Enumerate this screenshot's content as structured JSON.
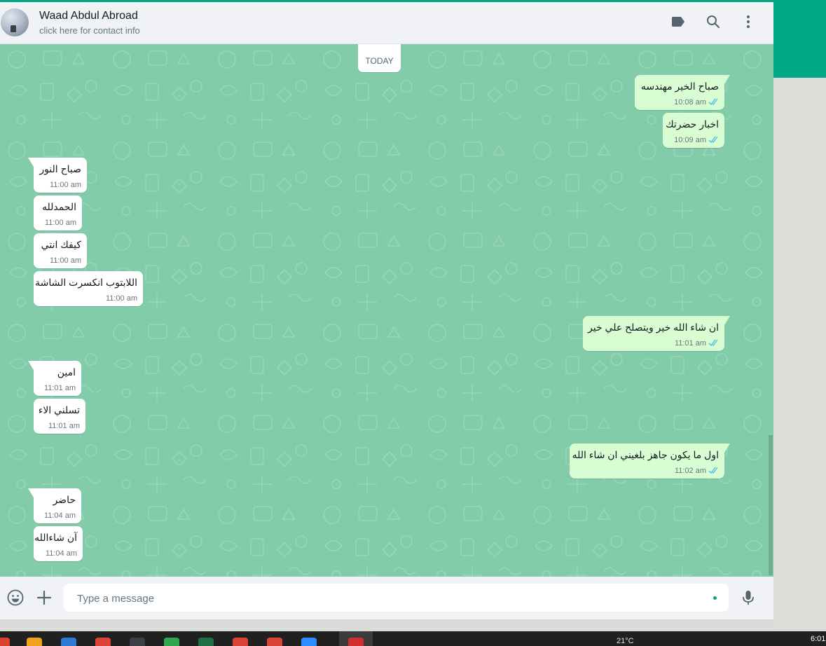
{
  "header": {
    "contact_name": "Waad Abdul Abroad",
    "contact_subtitle": "click here for contact info",
    "icons": [
      "label-icon",
      "search-icon",
      "menu-icon"
    ]
  },
  "chat": {
    "date_label": "TODAY",
    "messages": [
      {
        "direction": "out",
        "text": "صباح الخير مهندسه",
        "time": "10:08 am",
        "status": "read"
      },
      {
        "direction": "out",
        "text": "اخبار حضرتك",
        "time": "10:09 am",
        "status": "read"
      },
      {
        "direction": "in",
        "text": "صباح النور",
        "time": "11:00 am"
      },
      {
        "direction": "in",
        "text": "الحمدلله",
        "time": "11:00 am"
      },
      {
        "direction": "in",
        "text": "كيفك انتي",
        "time": "11:00 am"
      },
      {
        "direction": "in",
        "text": "اللابتوب انكسرت الشاشة",
        "time": "11:00 am"
      },
      {
        "direction": "out",
        "text": "ان شاء الله خير  ويتصلح علي خير",
        "time": "11:01 am",
        "status": "read"
      },
      {
        "direction": "in",
        "text": "امين",
        "time": "11:01 am"
      },
      {
        "direction": "in",
        "text": "تسلني الاء",
        "time": "11:01 am"
      },
      {
        "direction": "out",
        "text": "اول ما يكون جاهز بلغيني ان شاء الله",
        "time": "11:02 am",
        "status": "read"
      },
      {
        "direction": "in",
        "text": "حاضر",
        "time": "11:04 am"
      },
      {
        "direction": "in",
        "text": "آن شاءالله",
        "time": "11:04 am"
      }
    ]
  },
  "composer": {
    "placeholder": "Type a message",
    "icons": [
      "emoji-icon",
      "attach-plus-icon",
      "microphone-icon"
    ]
  },
  "taskbar": {
    "weather": "21°C",
    "clock": "6:01"
  },
  "colors": {
    "accent": "#00a884",
    "chat_background": "#82ccaa",
    "outgoing_bubble": "#d9fdd3",
    "incoming_bubble": "#ffffff",
    "read_ticks": "#53bdeb"
  }
}
